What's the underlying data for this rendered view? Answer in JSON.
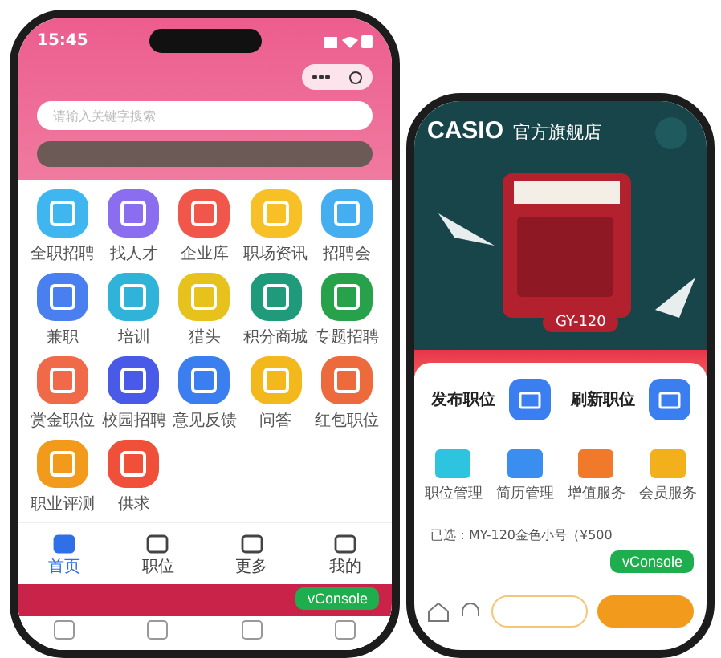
{
  "left": {
    "status": {
      "time": "15:45"
    },
    "search": {
      "placeholder": "请输入关键字搜索"
    },
    "grid": [
      {
        "label": "全职招聘",
        "color": "#3fb6f0"
      },
      {
        "label": "找人才",
        "color": "#8b6ef0"
      },
      {
        "label": "企业库",
        "color": "#f0564a"
      },
      {
        "label": "职场资讯",
        "color": "#f6c026"
      },
      {
        "label": "招聘会",
        "color": "#45aef0"
      },
      {
        "label": "兼职",
        "color": "#4a7ff0"
      },
      {
        "label": "培训",
        "color": "#2fb3d8"
      },
      {
        "label": "猎头",
        "color": "#e8c21c"
      },
      {
        "label": "积分商城",
        "color": "#1f9a7a"
      },
      {
        "label": "专题招聘",
        "color": "#27a24a"
      },
      {
        "label": "赏金职位",
        "color": "#f06a4a"
      },
      {
        "label": "校园招聘",
        "color": "#4a5ae8"
      },
      {
        "label": "意见反馈",
        "color": "#3a7ef0"
      },
      {
        "label": "问答",
        "color": "#f2b81c"
      },
      {
        "label": "红包职位",
        "color": "#ec6a3c"
      },
      {
        "label": "职业评测",
        "color": "#f29a1c"
      },
      {
        "label": "供求",
        "color": "#f0503a"
      }
    ],
    "tabs": [
      {
        "label": "首页",
        "selected": true
      },
      {
        "label": "职位",
        "selected": false
      },
      {
        "label": "更多",
        "selected": false
      },
      {
        "label": "我的",
        "selected": false
      }
    ],
    "console": "vConsole"
  },
  "right": {
    "brand": "CASIO",
    "store": "官方旗舰店",
    "model": "GY-120",
    "actions": [
      {
        "title": "发布职位"
      },
      {
        "title": "刷新职位"
      }
    ],
    "services": [
      {
        "label": "职位管理",
        "color": "#2ec4e0"
      },
      {
        "label": "简历管理",
        "color": "#3a8ef0"
      },
      {
        "label": "增值服务",
        "color": "#f07a2a"
      },
      {
        "label": "会员服务",
        "color": "#f2b01c"
      }
    ],
    "selection": "已选：MY-120金色小号（¥500",
    "console": "vConsole"
  }
}
